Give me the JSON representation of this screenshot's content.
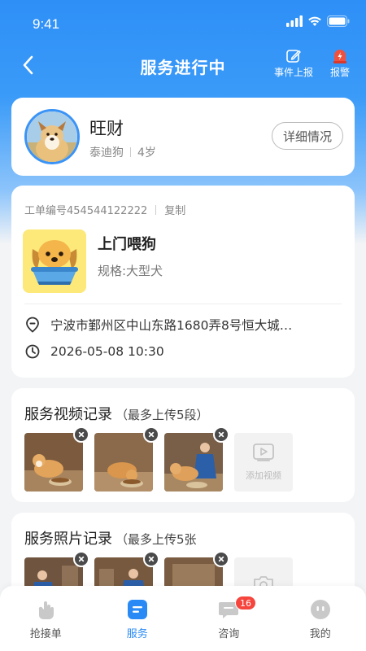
{
  "status_bar": {
    "time": "9:41"
  },
  "nav": {
    "title": "服务进行中",
    "report_label": "事件上报",
    "alarm_label": "报警"
  },
  "pet": {
    "name": "旺财",
    "breed": "泰迪狗",
    "age": "4岁",
    "detail_button": "详细情况"
  },
  "order": {
    "order_no": "工单编号454544122222",
    "copy_label": "复制",
    "service_title": "上门喂狗",
    "service_spec": "规格:大型犬",
    "address": "宁波市鄞州区中山东路1680弄8号恒大城…",
    "datetime": "2026-05-08 10:30"
  },
  "video_record": {
    "title": "服务视频记录",
    "hint": "（最多上传5段）",
    "add_label": "添加视频"
  },
  "photo_record": {
    "title": "服务照片记录",
    "hint": "（最多上传5张"
  },
  "tabbar": {
    "tabs": [
      {
        "label": "抢接单",
        "icon": "hand-icon"
      },
      {
        "label": "服务",
        "icon": "service-icon"
      },
      {
        "label": "咨询",
        "icon": "chat-icon",
        "badge": "16"
      },
      {
        "label": "我的",
        "icon": "profile-icon"
      }
    ],
    "active_index": 1
  },
  "colors": {
    "primary": "#2e8ff7",
    "badge": "#f5453d",
    "alarm": "#f0513f"
  }
}
